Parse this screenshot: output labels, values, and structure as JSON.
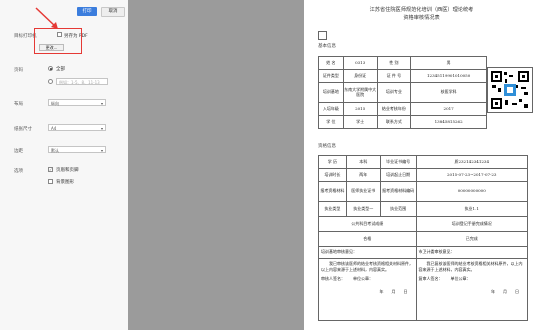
{
  "print": {
    "print_button": "打印",
    "cancel_button": "取消",
    "destination_label": "目标打印机",
    "destination_value": "另存为 PDF",
    "change_button": "更改...",
    "pages_label": "页码",
    "pages_all": "全部",
    "pages_placeholder": "例如：1-5、8、11-13",
    "layout_label": "布局",
    "layout_value": "纵向",
    "paper_label": "纸张尺寸",
    "paper_value": "A4",
    "margins_label": "边距",
    "margins_value": "默认",
    "options_label": "选项",
    "option_headers": "页眉和页脚",
    "option_background": "背景图形"
  },
  "doc": {
    "title1": "江苏省住院医师规范化培训（西医）理论统考",
    "title2": "资格审核情况表",
    "section_basic": "基本信息",
    "section_qual": "资格信息",
    "r1": [
      "姓 名",
      "0313",
      "性 别",
      "男"
    ],
    "r2": [
      "证件类型",
      "身份证",
      "证 件 号",
      "12345119901010050"
    ],
    "r3": [
      "培训基地",
      "东南大学附属中大医院",
      "培训专业",
      "核医学科"
    ],
    "r4": [
      "入培年级",
      "2015",
      "结业考核年份",
      "2017"
    ],
    "r5": [
      "学 位",
      "学士",
      "联系方式",
      "13845815262"
    ],
    "q1": [
      "学 历",
      "本科",
      "毕业证书编号",
      "质232142341234"
    ],
    "q2": [
      "培训时长",
      "两年",
      "培训起止日期",
      "2015-07-23~2017-07-23"
    ],
    "q3": [
      "报考资格材料",
      "医师执业证书",
      "报考资格材料编码",
      "00000000000"
    ],
    "q4": [
      "执业类型",
      "执业类型一",
      "执业范围",
      "执业1.1"
    ],
    "q5": [
      "公共科目考试成绩",
      "培训登记手册完成情况"
    ],
    "q6": [
      "合格",
      "已完成"
    ],
    "q7": [
      "培训基地审核意见：",
      "市卫计委审核意见："
    ],
    "statement_left": "我已审核该医师的结业考核资格相关材料原件，以上内容来源于上述材料，内容真实。",
    "statement_right": "我已复核该医师的结业考核资格相关材料原件，以上内容来源于上述材料，内容真实。",
    "sign_left": "审核人签名：",
    "unit_left": "单位公章：",
    "sign_right": "复审人签名：",
    "unit_right": "单位公章：",
    "date_left": "年　　月　　日",
    "date_right": "年　　月　　日"
  },
  "colors": {
    "primary_button": "#3b7ddd",
    "highlight": "#e53935",
    "gray_bg": "#9b9b9b"
  }
}
